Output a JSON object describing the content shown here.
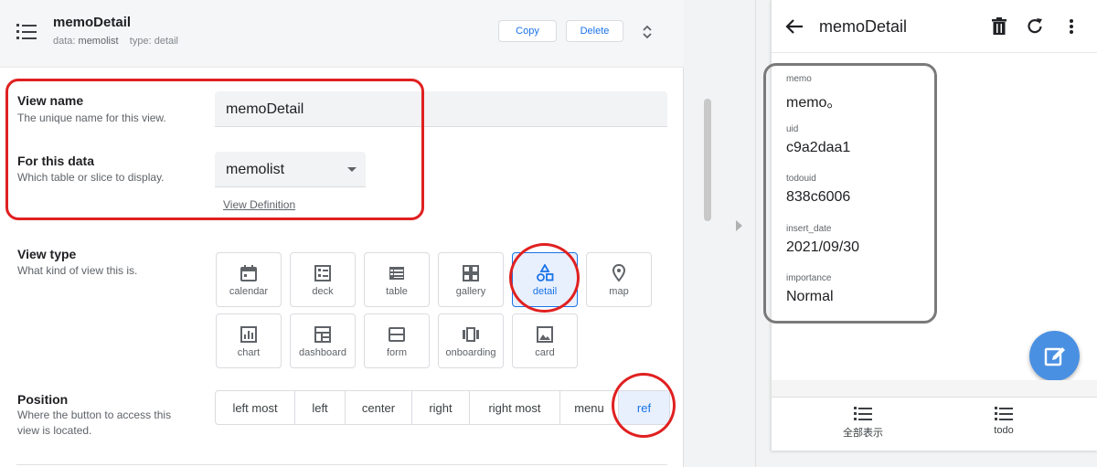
{
  "editor": {
    "title": "memoDetail",
    "meta_data_label": "data:",
    "meta_data_value": "memolist",
    "meta_type_label": "type:",
    "meta_type_value": "detail",
    "copy_label": "Copy",
    "delete_label": "Delete"
  },
  "view_name": {
    "label": "View name",
    "desc": "The unique name for this view.",
    "value": "memoDetail"
  },
  "for_data": {
    "label": "For this data",
    "desc": "Which table or slice to display.",
    "value": "memolist",
    "link": "View Definition"
  },
  "view_type": {
    "label": "View type",
    "desc": "What kind of view this is.",
    "tiles": [
      "calendar",
      "deck",
      "table",
      "gallery",
      "detail",
      "map",
      "chart",
      "dashboard",
      "form",
      "onboarding",
      "card"
    ],
    "selected": "detail"
  },
  "position": {
    "label": "Position",
    "desc_line1": "Where the button to access this",
    "desc_line2": "view is located.",
    "options": [
      "left most",
      "left",
      "center",
      "right",
      "right most",
      "menu",
      "ref"
    ],
    "selected": "ref"
  },
  "preview": {
    "title": "memoDetail",
    "fields": [
      {
        "label": "memo",
        "value": "memo。"
      },
      {
        "label": "uid",
        "value": "c9a2daa1"
      },
      {
        "label": "todouid",
        "value": "838c6006"
      },
      {
        "label": "insert_date",
        "value": "2021/09/30"
      },
      {
        "label": "importance",
        "value": "Normal"
      }
    ],
    "nav": [
      {
        "label": "全部表示"
      },
      {
        "label": "todo"
      }
    ]
  },
  "colors": {
    "accent": "#1a73e8",
    "annotation_red": "#e02020",
    "fab": "#4a90e2"
  }
}
